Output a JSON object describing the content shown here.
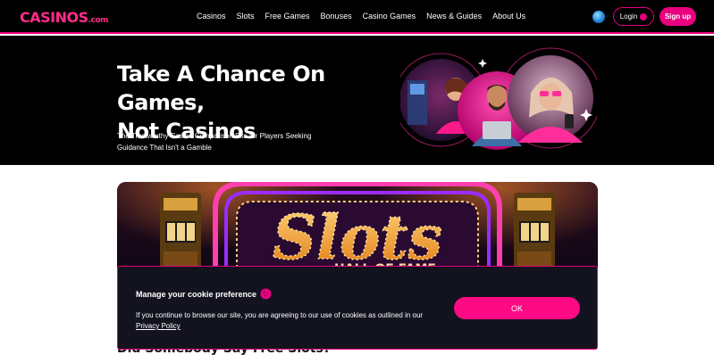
{
  "header": {
    "logo_text": "CASINOS",
    "logo_suffix": ".com",
    "nav": [
      "Casinos",
      "Slots",
      "Free Games",
      "Bonuses",
      "Casino Games",
      "News & Guides",
      "About Us"
    ],
    "login_label": "Login",
    "signup_label": "Sign up"
  },
  "hero": {
    "title_line1": "Take A Chance On Games,",
    "title_line2": "Not Casinos",
    "subtitle": "The Trustworthy Casino Comparison Site for Players Seeking Guidance That Isn't a Gamble"
  },
  "banner": {
    "sign_text": "Slots",
    "sign_subtext": "HALL OF FAME"
  },
  "section": {
    "heading": "Did Somebody Say Free Slots?"
  },
  "cookie": {
    "title": "Manage your cookie preference",
    "body": "If you continue to browse our site, you are agreeing to our use of cookies as outlined in our",
    "link": "Privacy Policy",
    "ok_label": "OK"
  },
  "colors": {
    "accent": "#e8007f",
    "header_bg": "#000000",
    "cookie_bg": "#12131f"
  }
}
